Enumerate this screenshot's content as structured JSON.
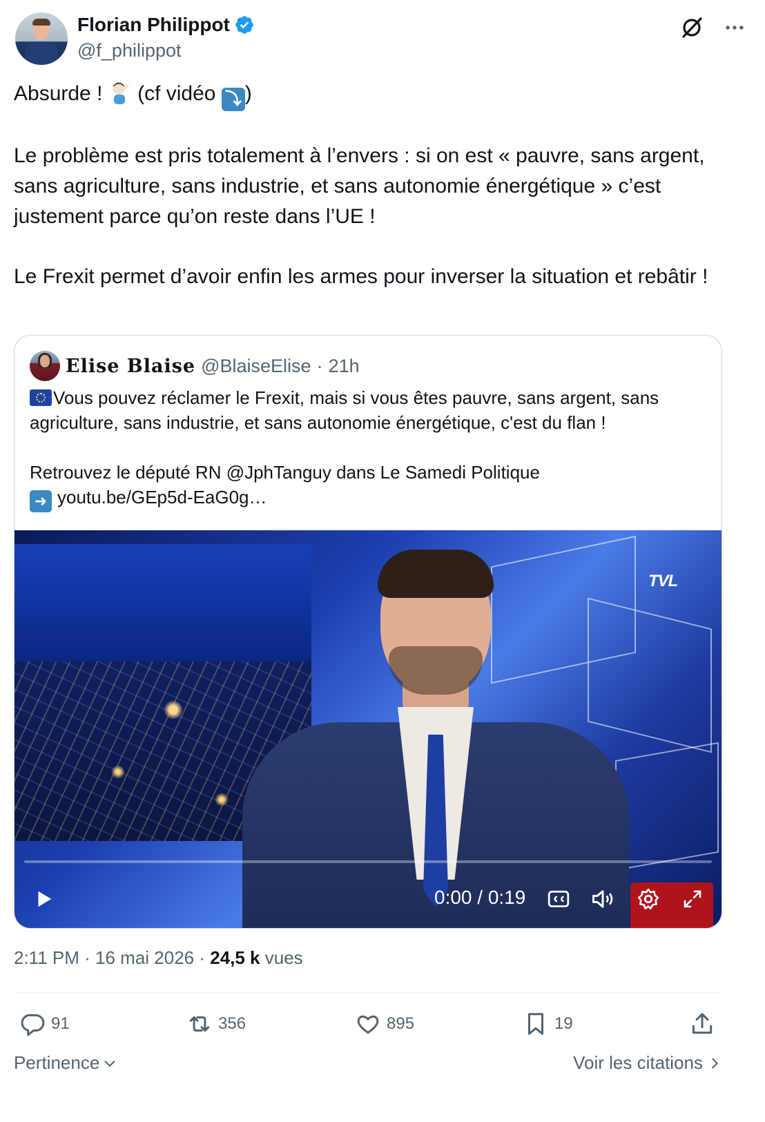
{
  "author": {
    "name": "Florian Philippot",
    "handle": "@f_philippot"
  },
  "tweet": {
    "line1_a": "Absurde ! ",
    "line1_b": " (cf vidéo ",
    "line1_c": ")",
    "para2": "Le problème est pris totalement à l’envers : si on est « pauvre, sans argent, sans agriculture, sans industrie, et sans autonomie énergétique » c’est justement parce qu’on reste dans l’UE !",
    "para3": "Le Frexit permet d’avoir enfin les armes pour inverser la situation et rebâtir !"
  },
  "quote": {
    "name": "Elise Blaise",
    "handle": "@BlaiseElise",
    "separator": "·",
    "time": "21h",
    "para1": "Vous pouvez réclamer le Frexit, mais si vous êtes pauvre, sans argent, sans agriculture, sans industrie, et sans autonomie énergétique, c'est du flan !",
    "para2": "Retrouvez le député RN @JphTanguy dans Le Samedi Politique",
    "link": "youtu.be/GEp5d-EaG0g…"
  },
  "video": {
    "channel_logo": "TVL",
    "time_display": "0:00 / 0:19",
    "progress": 0
  },
  "meta": {
    "time": "2:11 PM",
    "dot": " · ",
    "date": "16 mai 2026",
    "views_count": "24,5 k",
    "views_label": "vues"
  },
  "actions": {
    "replies": "91",
    "reposts": "356",
    "likes": "895",
    "bookmarks": "19"
  },
  "footer": {
    "sort_label": "Pertinence",
    "quotes_link": "Voir les citations"
  },
  "colors": {
    "text": "#0f1419",
    "secondary": "#536471",
    "verified": "#1d9bf0",
    "border": "#cfd9de"
  },
  "icons": [
    "verified-badge-icon",
    "grok-icon",
    "more-icon",
    "play-icon",
    "captions-icon",
    "volume-icon",
    "settings-icon",
    "fullscreen-icon",
    "reply-icon",
    "repost-icon",
    "like-icon",
    "bookmark-icon",
    "share-icon",
    "chevron-down-icon",
    "chevron-right-icon"
  ]
}
